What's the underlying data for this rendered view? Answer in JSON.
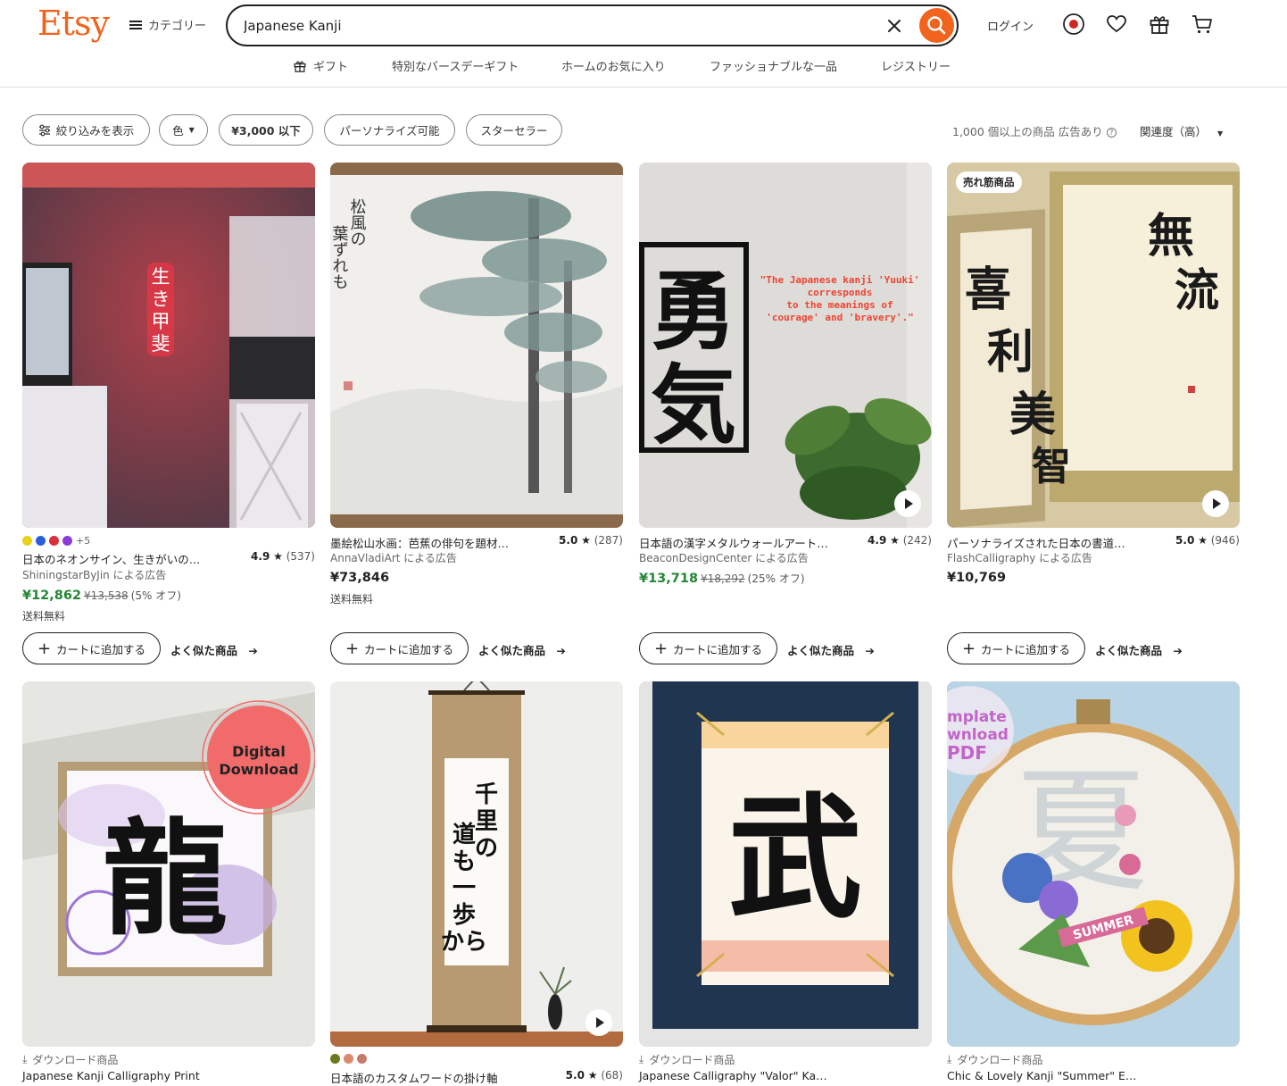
{
  "header": {
    "logo": "Etsy",
    "categories_label": "カテゴリー",
    "search_value": "Japanese Kanji",
    "login_label": "ログイン"
  },
  "subnav": [
    "ギフト",
    "特別なバースデーギフト",
    "ホームのお気に入り",
    "ファッショナブルな一品",
    "レジストリー"
  ],
  "filters": {
    "show_filters": "絞り込みを表示",
    "color": "色",
    "price": "¥3,000 以下",
    "personalizable": "パーソナライズ可能",
    "star_seller": "スターセラー",
    "results": "1,000 個以上の商品 広告あり",
    "sort": "関連度（高）"
  },
  "card_common": {
    "add_to_cart": "カートに追加する",
    "similar": "よく似た商品",
    "download": "ダウンロード商品"
  },
  "products": [
    {
      "title": "日本のネオンサイン、生きがいの…",
      "rating": "4.9",
      "reviews": "(537)",
      "shop": "ShiningstarByJin による広告",
      "price": "¥12,862",
      "original_price": "¥13,538",
      "discount": "(5% オフ)",
      "shipping": "送料無料",
      "swatch_more": "+5",
      "swatch_colors": [
        "#e8d21e",
        "#2b5fd9",
        "#d9303a",
        "#8a3cd9"
      ]
    },
    {
      "title": "墨絵松山水画：芭蕉の俳句を題材…",
      "rating": "5.0",
      "reviews": "(287)",
      "shop": "AnnaVladiArt による広告",
      "price": "¥73,846",
      "shipping": "送料無料"
    },
    {
      "title": "日本語の漢字メタルウォールアート…",
      "rating": "4.9",
      "reviews": "(242)",
      "shop": "BeaconDesignCenter による広告",
      "price": "¥13,718",
      "original_price": "¥18,292",
      "discount": "(25% オフ)",
      "image_text": [
        "\"The Japanese kanji 'Yuuki'",
        "corresponds",
        "to the meanings of",
        "'courage' and 'bravery'.\""
      ],
      "kanji": "勇気"
    },
    {
      "badge": "売れ筋商品",
      "title": "パーソナライズされた日本の書道…",
      "rating": "5.0",
      "reviews": "(946)",
      "shop": "FlashCalligraphy による広告",
      "price": "¥10,769"
    },
    {
      "title": "Japanese Kanji Calligraphy Print",
      "kanji": "龍",
      "image_text": [
        "Digital",
        "Download"
      ]
    },
    {
      "title": "日本語のカスタムワードの掛け軸",
      "rating": "5.0",
      "reviews": "(68)",
      "swatch_colors": [
        "#6b7a1e",
        "#d98a6a",
        "#c87a6a"
      ],
      "scroll_text": [
        "千里の",
        "道も",
        "一歩から"
      ]
    },
    {
      "title": "Japanese Calligraphy \"Valor\" Ka…",
      "kanji": "武"
    },
    {
      "title": "Chic & Lovely Kanji \"Summer\" E…",
      "image_text": [
        "mplate",
        "wnload",
        "PDF"
      ],
      "banner": "SUMMER"
    }
  ],
  "neon_text": "生き甲斐",
  "pine_poem": "松風の葉ずれも"
}
